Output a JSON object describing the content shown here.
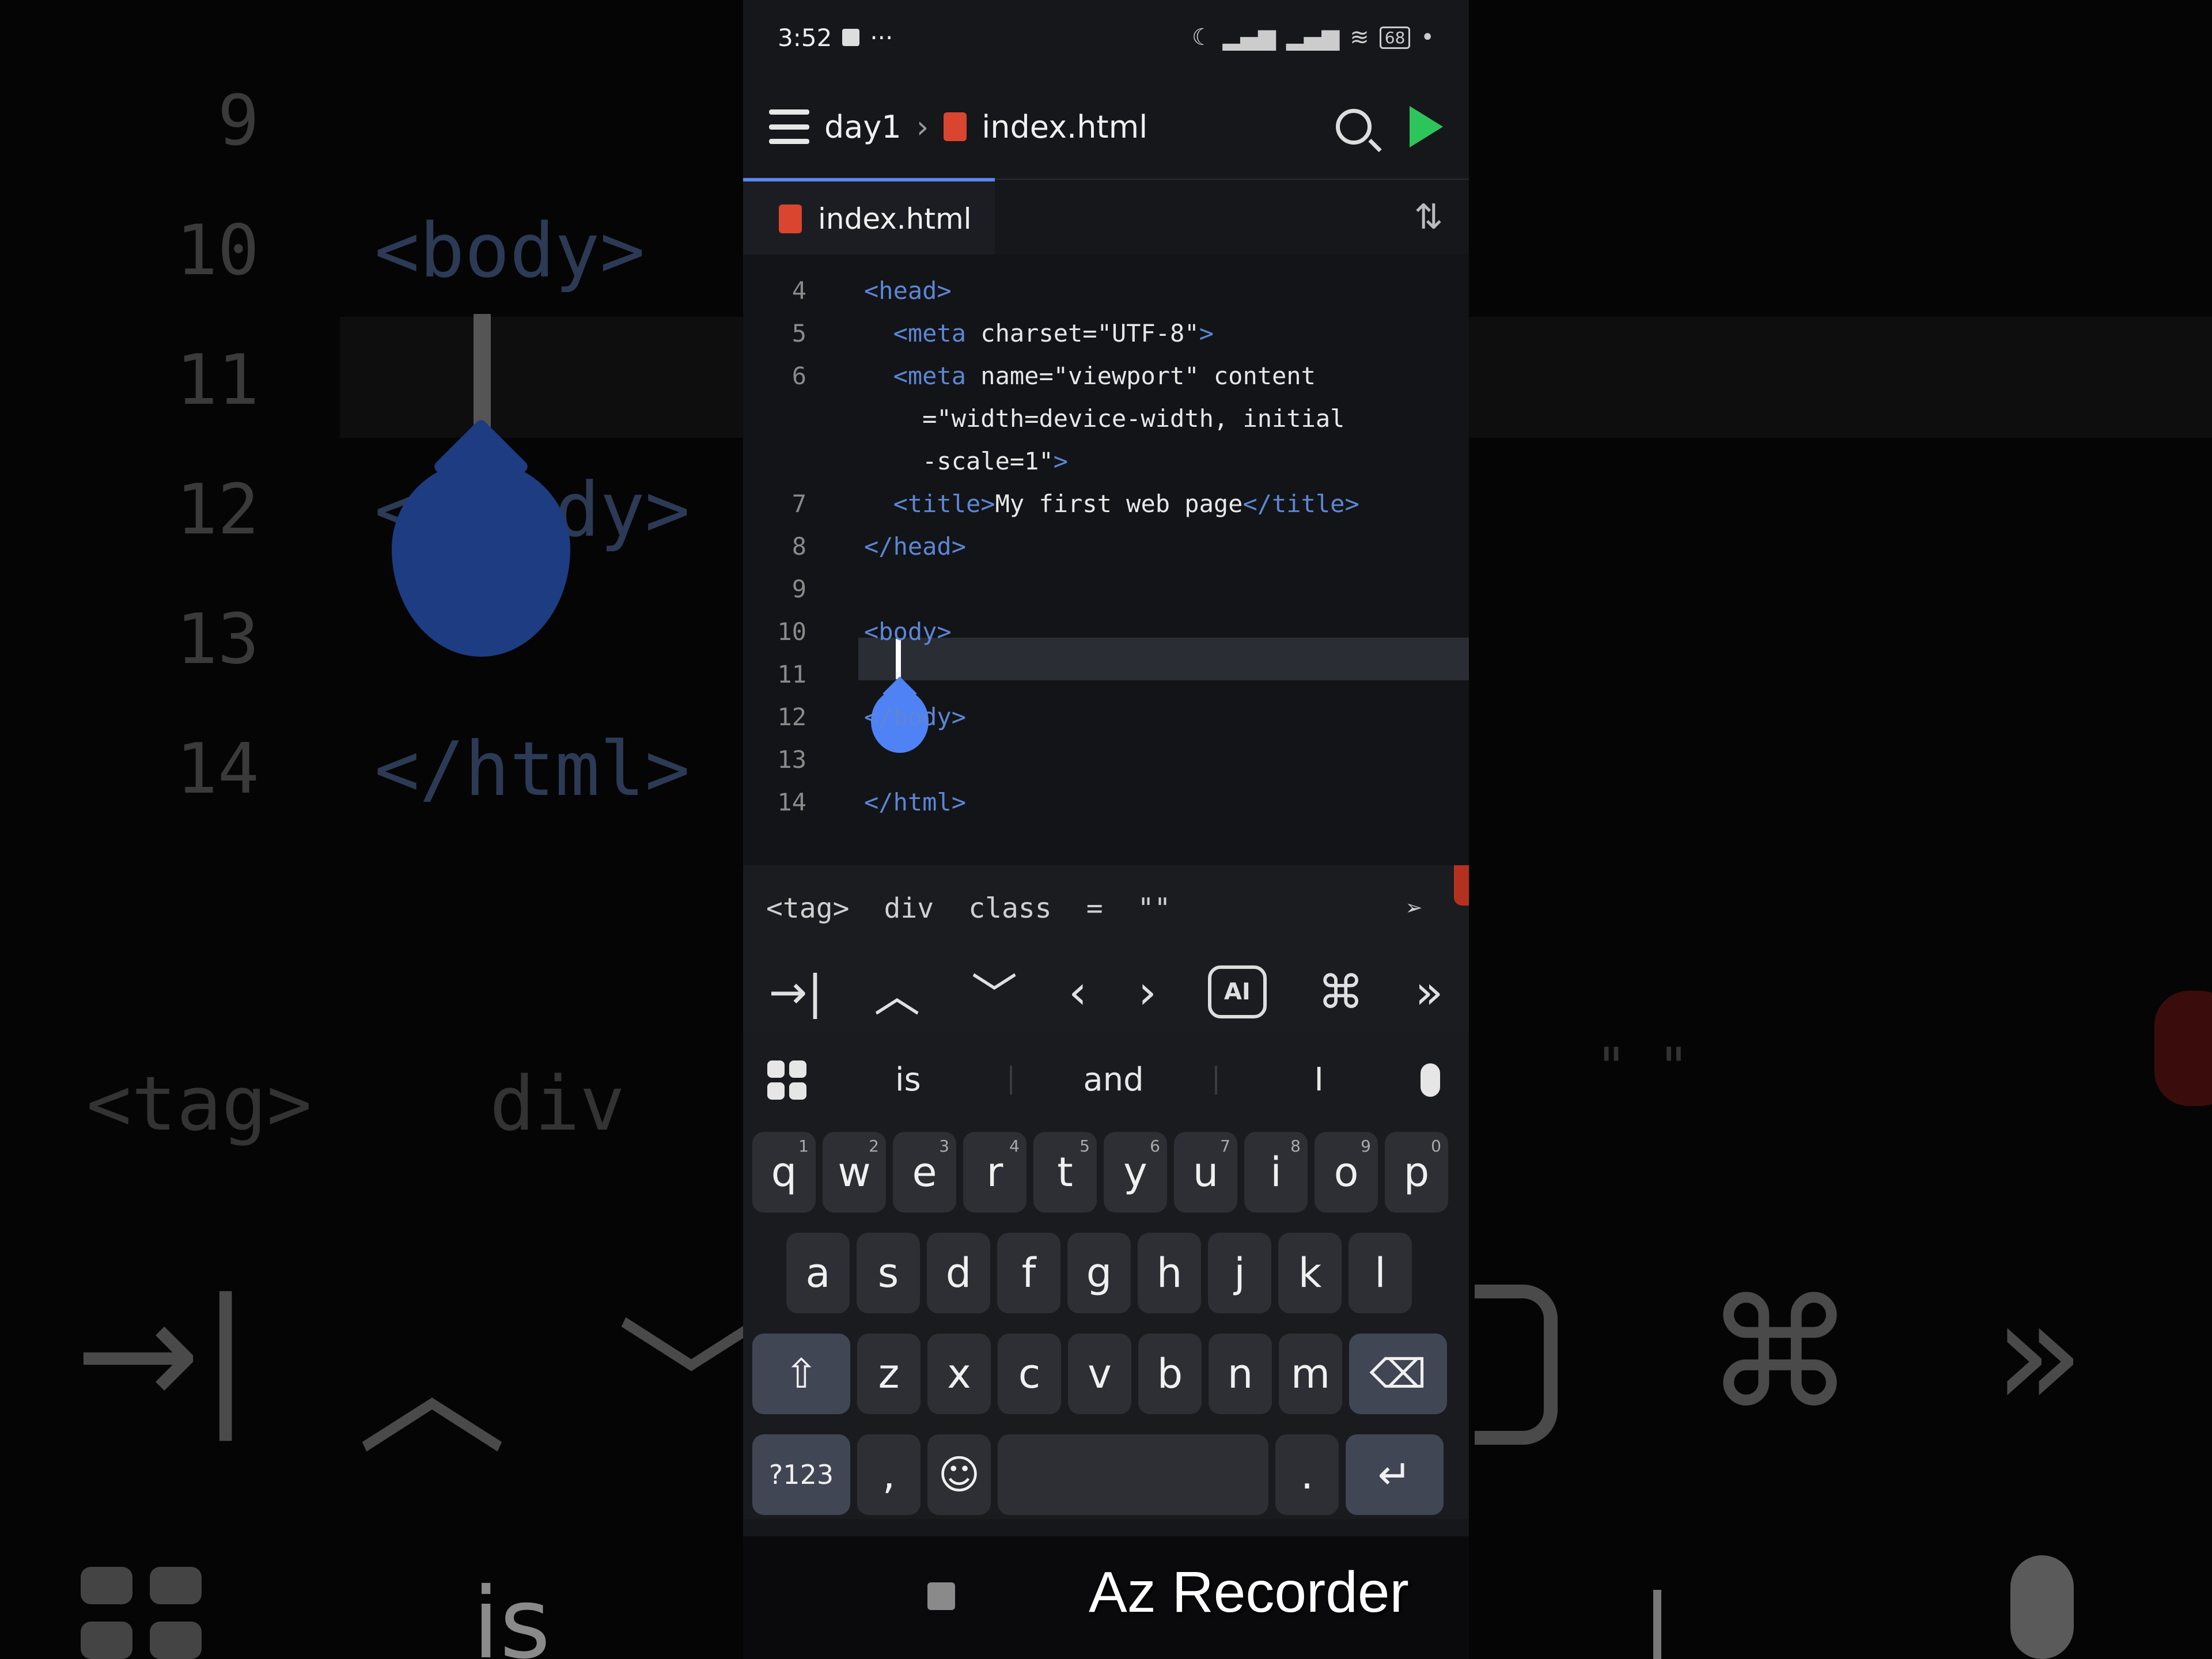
{
  "status": {
    "time": "3:52",
    "dots": "···",
    "battery": "68"
  },
  "header": {
    "folder": "day1",
    "file": "index.html"
  },
  "tab": {
    "label": "index.html"
  },
  "editor": {
    "lines": [
      {
        "n": "4",
        "tokens": [
          {
            "t": "<head>",
            "c": "tag"
          }
        ]
      },
      {
        "n": "5",
        "tokens": [
          {
            "t": "  <meta ",
            "c": "tag"
          },
          {
            "t": "charset=\"UTF-8\"",
            "c": "attr"
          },
          {
            "t": ">",
            "c": "tag"
          }
        ]
      },
      {
        "n": "6",
        "tokens": [
          {
            "t": "  <meta ",
            "c": "tag"
          },
          {
            "t": "name=\"viewport\" content",
            "c": "attr"
          }
        ]
      },
      {
        "n": "",
        "tokens": [
          {
            "t": "    =\"width=device-width, initial",
            "c": "str"
          }
        ]
      },
      {
        "n": "",
        "tokens": [
          {
            "t": "    -scale=1\"",
            "c": "str"
          },
          {
            "t": ">",
            "c": "tag"
          }
        ]
      },
      {
        "n": "7",
        "tokens": [
          {
            "t": "  <title>",
            "c": "tag"
          },
          {
            "t": "My first web page",
            "c": "str"
          },
          {
            "t": "</title>",
            "c": "tag"
          }
        ]
      },
      {
        "n": "8",
        "tokens": [
          {
            "t": "</head>",
            "c": "tag"
          }
        ]
      },
      {
        "n": "9",
        "tokens": []
      },
      {
        "n": "10",
        "tokens": [
          {
            "t": "<body>",
            "c": "tag"
          }
        ]
      },
      {
        "n": "11",
        "tokens": []
      },
      {
        "n": "12",
        "tokens": [
          {
            "t": "</body>",
            "c": "tag"
          }
        ]
      },
      {
        "n": "13",
        "tokens": []
      },
      {
        "n": "14",
        "tokens": [
          {
            "t": "</html>",
            "c": "tag"
          }
        ]
      }
    ]
  },
  "shortcuts": [
    "<tag>",
    "div",
    "class",
    "=",
    "\"\""
  ],
  "suggestions": [
    "is",
    "and",
    "I"
  ],
  "keyboard": {
    "row1": [
      {
        "k": "q",
        "s": "1"
      },
      {
        "k": "w",
        "s": "2"
      },
      {
        "k": "e",
        "s": "3"
      },
      {
        "k": "r",
        "s": "4"
      },
      {
        "k": "t",
        "s": "5"
      },
      {
        "k": "y",
        "s": "6"
      },
      {
        "k": "u",
        "s": "7"
      },
      {
        "k": "i",
        "s": "8"
      },
      {
        "k": "o",
        "s": "9"
      },
      {
        "k": "p",
        "s": "0"
      }
    ],
    "row2": [
      "a",
      "s",
      "d",
      "f",
      "g",
      "h",
      "j",
      "k",
      "l"
    ],
    "row3": [
      "z",
      "x",
      "c",
      "v",
      "b",
      "n",
      "m"
    ],
    "symbols": "?123",
    "comma": ",",
    "period": "."
  },
  "recorder": {
    "label": "Az Recorder"
  },
  "background": {
    "lines": [
      {
        "n": "9",
        "code": ""
      },
      {
        "n": "10",
        "code": "<body>"
      },
      {
        "n": "11",
        "code": ""
      },
      {
        "n": "12",
        "code": "</body>"
      },
      {
        "n": "13",
        "code": ""
      },
      {
        "n": "14",
        "code": "</html>"
      }
    ],
    "shortcut1": "<tag>",
    "shortcut2": "div",
    "shortcut3": "\" \"",
    "word": "is"
  },
  "colors": {
    "tag": "#5c86d6",
    "accent": "#4f82f5",
    "run": "#2ec45c"
  }
}
